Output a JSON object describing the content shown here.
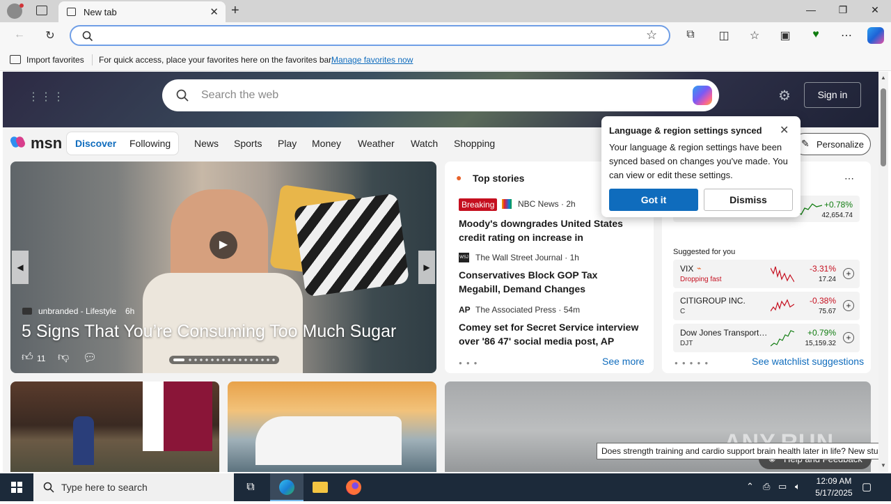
{
  "browser": {
    "tab_title": "New tab",
    "address_value": "",
    "favorites_bar": {
      "import_label": "Import favorites",
      "hint": "For quick access, place your favorites here on the favorites bar.",
      "manage_link": "Manage favorites now"
    }
  },
  "msn": {
    "search_placeholder": "Search the web",
    "sign_in": "Sign in",
    "logo": "msn",
    "nav": {
      "discover": "Discover",
      "following": "Following",
      "items": [
        "News",
        "Sports",
        "Play",
        "Money",
        "Weather",
        "Watch",
        "Shopping"
      ]
    },
    "personalize": "Personalize",
    "hero": {
      "source": "unbranded - Lifestyle",
      "age": "6h",
      "title": "5 Signs That You’re Consuming Too Much Sugar",
      "likes": "11"
    },
    "top_stories": {
      "title": "Top stories",
      "stories": [
        {
          "badge": "Breaking",
          "source": "NBC News · 2h",
          "headline": "Moody's downgrades United States credit rating on increase in government…"
        },
        {
          "badge": "",
          "source": "The Wall Street Journal · 1h",
          "headline": "Conservatives Block GOP Tax Megabill, Demand Changes"
        },
        {
          "badge": "",
          "source": "The Associated Press · 54m",
          "headline": "Comey set for Secret Service interview over '86 47' social media post, AP sour…"
        }
      ],
      "see_more": "See more"
    },
    "watchlist": {
      "top_change": "+0.78%",
      "top_price": "42,654.74",
      "suggested_label": "Suggested for you",
      "rows": [
        {
          "name": "VIX",
          "sub": "Dropping fast",
          "change": "-3.31%",
          "price": "17.24",
          "dir": "down"
        },
        {
          "name": "CITIGROUP INC.",
          "sub": "C",
          "change": "-0.38%",
          "price": "75.67",
          "dir": "down"
        },
        {
          "name": "Dow Jones Transport…",
          "sub": "DJT",
          "change": "+0.79%",
          "price": "15,159.32",
          "dir": "up"
        }
      ],
      "see_suggestions": "See watchlist suggestions"
    },
    "popup": {
      "title": "Language & region settings synced",
      "body": "Your language & region settings have been synced based on changes you've made. You can view or edit these settings.",
      "got_it": "Got it",
      "dismiss": "Dismiss"
    },
    "tooltip": "Does strength training and cardio support brain health later in life? New study",
    "feedback": "Help and Feedback",
    "watermark": "ANY.RUN"
  },
  "taskbar": {
    "search_placeholder": "Type here to search",
    "time": "12:09 AM",
    "date": "5/17/2025"
  },
  "colors": {
    "accent": "#0f6cbd",
    "positive": "#107c10",
    "negative": "#c50f1f",
    "breaking": "#c50f1f",
    "taskbar": "#1c2a3a"
  }
}
